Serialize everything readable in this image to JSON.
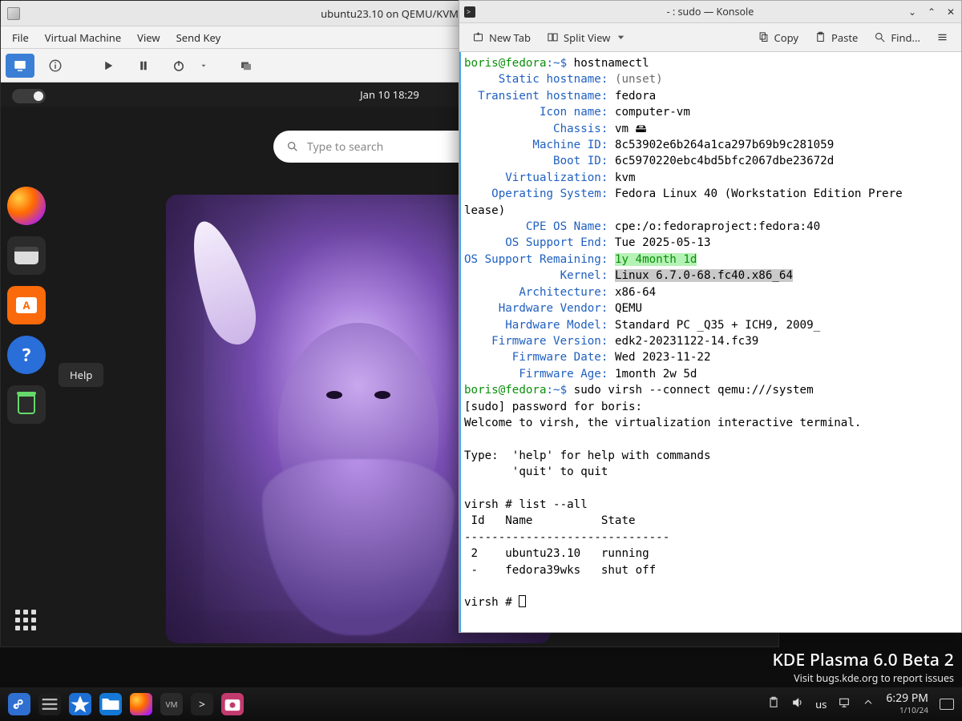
{
  "vm": {
    "title": "ubuntu23.10 on QEMU/KVM",
    "menu": {
      "file": "File",
      "virtual_machine": "Virtual Machine",
      "view": "View",
      "send_key": "Send Key"
    },
    "guest": {
      "clock": "Jan 10  18:29",
      "search_placeholder": "Type to search",
      "help_tooltip": "Help"
    }
  },
  "konsole": {
    "title": "- : sudo — Konsole",
    "toolbar": {
      "new_tab": "New Tab",
      "split_view": "Split View",
      "copy": "Copy",
      "paste": "Paste",
      "find": "Find..."
    },
    "prompt": {
      "user_host": "boris@fedora",
      "path": ":~$"
    },
    "cmd1": "hostnamectl",
    "host": {
      "static_hostname_k": "Static hostname:",
      "static_hostname_v": "(unset)",
      "transient_hostname_k": "Transient hostname:",
      "transient_hostname_v": "fedora",
      "icon_name_k": "Icon name:",
      "icon_name_v": "computer-vm",
      "chassis_k": "Chassis:",
      "chassis_v": "vm 🖴",
      "machine_id_k": "Machine ID:",
      "machine_id_v": "8c53902e6b264a1ca297b69b9c281059",
      "boot_id_k": "Boot ID:",
      "boot_id_v": "6c5970220ebc4bd5bfc2067dbe23672d",
      "virtualization_k": "Virtualization:",
      "virtualization_v": "kvm",
      "os_k": "Operating System:",
      "os_v": "Fedora Linux 40 (Workstation Edition Prere",
      "os_wrap": "lease)",
      "cpe_k": "CPE OS Name:",
      "cpe_v": "cpe:/o:fedoraproject:fedora:40",
      "support_end_k": "OS Support End:",
      "support_end_v": "Tue 2025-05-13",
      "support_rem_k": "OS Support Remaining:",
      "support_rem_v": "1y 4month 1d",
      "kernel_k": "Kernel:",
      "kernel_v": "Linux 6.7.0-68.fc40.x86_64",
      "arch_k": "Architecture:",
      "arch_v": "x86-64",
      "hw_vendor_k": "Hardware Vendor:",
      "hw_vendor_v": "QEMU",
      "hw_model_k": "Hardware Model:",
      "hw_model_v": "Standard PC _Q35 + ICH9, 2009_",
      "fw_ver_k": "Firmware Version:",
      "fw_ver_v": "edk2-20231122-14.fc39",
      "fw_date_k": "Firmware Date:",
      "fw_date_v": "Wed 2023-11-22",
      "fw_age_k": "Firmware Age:",
      "fw_age_v": "1month 2w 5d"
    },
    "cmd2": "sudo virsh --connect qemu:///system",
    "sudo_prompt": "[sudo] password for boris:",
    "virsh_welcome": "Welcome to virsh, the virtualization interactive terminal.",
    "virsh_help1": "Type:  'help' for help with commands",
    "virsh_help2": "       'quit' to quit",
    "virsh_prompt": "virsh #",
    "virsh_cmd": "list --all",
    "virsh_header": " Id   Name          State",
    "virsh_sep": "------------------------------",
    "virsh_rows": [
      {
        "id": "2",
        "name": "ubuntu23.10",
        "state": "running"
      },
      {
        "id": "-",
        "name": "fedora39wks",
        "state": "shut off"
      }
    ]
  },
  "desktop": {
    "brand_big": "KDE Plasma 6.0 Beta 2",
    "brand_small": "Visit bugs.kde.org to report issues"
  },
  "panel": {
    "kb_layout": "us",
    "time": "6:29 PM",
    "date": "1/10/24"
  }
}
